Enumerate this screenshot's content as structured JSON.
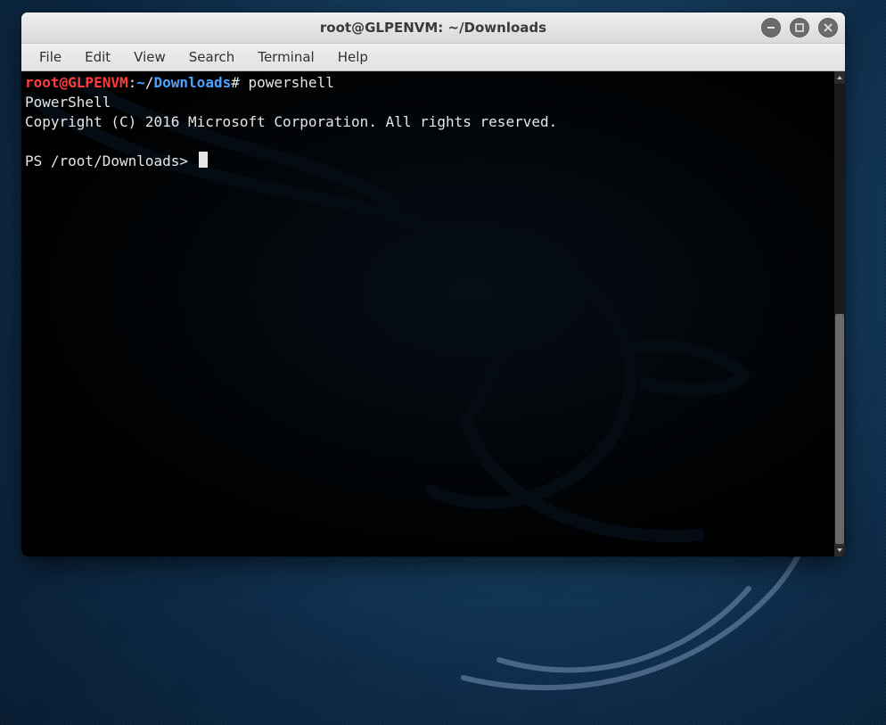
{
  "window": {
    "title": "root@GLPENVM: ~/Downloads"
  },
  "menubar": {
    "items": [
      "File",
      "Edit",
      "View",
      "Search",
      "Terminal",
      "Help"
    ]
  },
  "terminal": {
    "prompt_user": "root@GLPENVM",
    "prompt_sep1": ":",
    "prompt_tilde": "~",
    "prompt_slash": "/",
    "prompt_dir": "Downloads",
    "prompt_hash": "#",
    "command": "powershell",
    "line_powershell": "PowerShell",
    "line_copyright": "Copyright (C) 2016 Microsoft Corporation. All rights reserved.",
    "ps_prompt": "PS /root/Downloads>"
  },
  "icons": {
    "minimize": "minimize-icon",
    "maximize": "maximize-icon",
    "close": "close-icon"
  }
}
